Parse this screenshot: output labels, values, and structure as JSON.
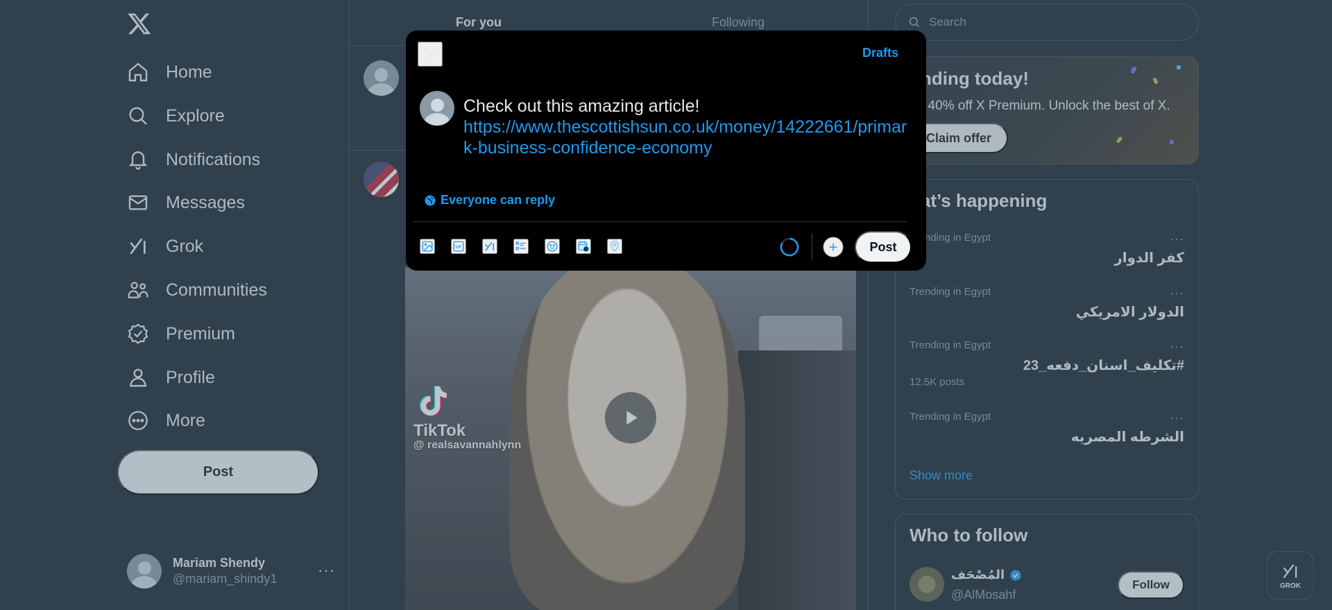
{
  "nav": {
    "items": [
      {
        "label": "Home",
        "icon": "home-icon"
      },
      {
        "label": "Explore",
        "icon": "search-icon"
      },
      {
        "label": "Notifications",
        "icon": "bell-icon"
      },
      {
        "label": "Messages",
        "icon": "mail-icon"
      },
      {
        "label": "Grok",
        "icon": "grok-icon"
      },
      {
        "label": "Communities",
        "icon": "communities-icon"
      },
      {
        "label": "Premium",
        "icon": "premium-badge-icon"
      },
      {
        "label": "Profile",
        "icon": "person-icon"
      },
      {
        "label": "More",
        "icon": "more-circle-icon"
      }
    ],
    "post_label": "Post"
  },
  "account": {
    "name": "Mariam Shendy",
    "handle": "@mariam_shindy1",
    "more": "···"
  },
  "feed": {
    "tabs": [
      {
        "label": "For you",
        "active": true
      },
      {
        "label": "Following",
        "active": false
      }
    ],
    "video": {
      "brand": "TikTok",
      "username": "@ realsavannahlynn"
    }
  },
  "sidebar": {
    "search_placeholder": "Search",
    "premium": {
      "title": "nding today!",
      "subtitle": "t 40% off X Premium. Unlock the best of X.",
      "cta": "Claim offer"
    },
    "happening": {
      "title": "hat’s happening",
      "trends": [
        {
          "context": "Trending in Egypt",
          "name": "كفر الدوار",
          "count": ""
        },
        {
          "context": "Trending in Egypt",
          "name": "الدولار الامريكي",
          "count": ""
        },
        {
          "context": "Trending in Egypt",
          "name": "#تكليف_اسنان_دفعه_23",
          "count": "12.5K posts"
        },
        {
          "context": "Trending in Egypt",
          "name": "الشرطه المصريه",
          "count": ""
        }
      ],
      "more_dots": "···",
      "show_more": "Show more"
    },
    "who_to_follow": {
      "title": "Who to follow",
      "name": "المُصْحَف",
      "handle": "@AlMosahf",
      "follow_label": "Follow"
    }
  },
  "grok_fab": {
    "label": "GROK"
  },
  "compose": {
    "drafts_label": "Drafts",
    "text": "Check out this amazing article!",
    "link": "https://www.thescottishsun.co.uk/money/14222661/primark-business-confidence-economy",
    "reply_setting": "Everyone can reply",
    "post_label": "Post"
  },
  "colors": {
    "accent": "#1d9bf0",
    "background": "#15202b",
    "modal": "#000000"
  }
}
